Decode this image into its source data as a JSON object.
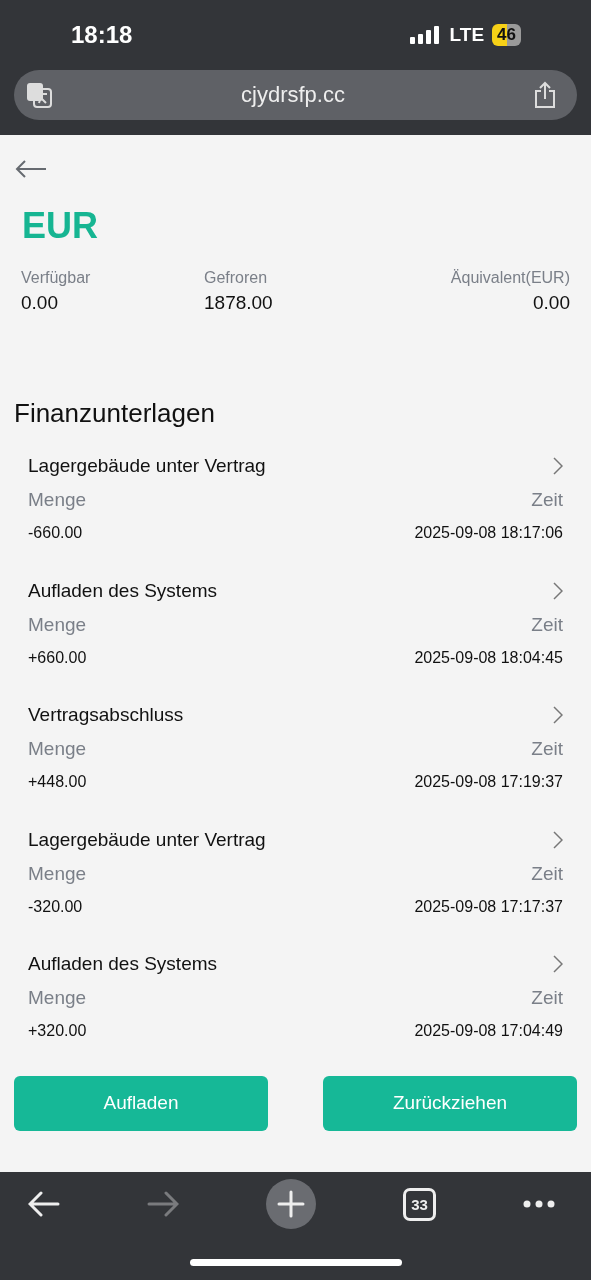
{
  "status_bar": {
    "time": "18:18",
    "network": "LTE",
    "battery": "46"
  },
  "address_bar": {
    "url": "cjydrsfp.cc"
  },
  "header": {
    "currency": "EUR"
  },
  "balances": [
    {
      "label": "Verfügbar",
      "value": "0.00"
    },
    {
      "label": "Gefroren",
      "value": "1878.00"
    },
    {
      "label": "Äquivalent(EUR)",
      "value": "0.00"
    }
  ],
  "records_title": "Finanzunterlagen",
  "records": [
    {
      "title": "Lagergebäude unter Vertrag",
      "amount_label": "Menge",
      "time_label": "Zeit",
      "amount": "-660.00",
      "time": "2025-09-08 18:17:06"
    },
    {
      "title": "Aufladen des Systems",
      "amount_label": "Menge",
      "time_label": "Zeit",
      "amount": "+660.00",
      "time": "2025-09-08 18:04:45"
    },
    {
      "title": "Vertragsabschluss",
      "amount_label": "Menge",
      "time_label": "Zeit",
      "amount": "+448.00",
      "time": "2025-09-08 17:19:37"
    },
    {
      "title": "Lagergebäude unter Vertrag",
      "amount_label": "Menge",
      "time_label": "Zeit",
      "amount": "-320.00",
      "time": "2025-09-08 17:17:37"
    },
    {
      "title": "Aufladen des Systems",
      "amount_label": "Menge",
      "time_label": "Zeit",
      "amount": "+320.00",
      "time": "2025-09-08 17:04:49"
    }
  ],
  "buttons": [
    "Aufladen",
    "Zurückziehen"
  ],
  "browser_toolbar": {
    "forward_disabled": true,
    "tab_count": "33"
  }
}
